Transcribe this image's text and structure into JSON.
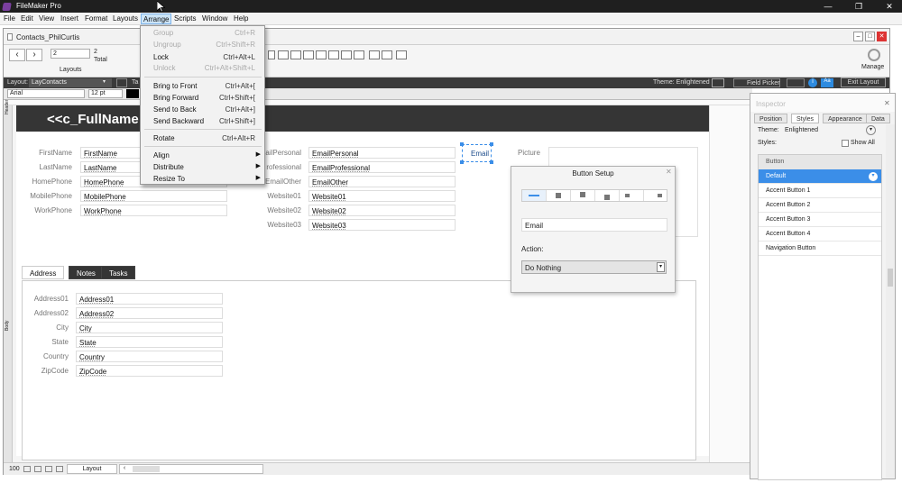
{
  "app": {
    "title": "FileMaker Pro"
  },
  "menu": [
    "File",
    "Edit",
    "View",
    "Insert",
    "Format",
    "Layouts",
    "Arrange",
    "Scripts",
    "Window",
    "Help"
  ],
  "doc": {
    "title": "Contacts_PhilCurtis",
    "record_value": "2",
    "record_count": "2",
    "total_label": "Total",
    "layouts_label": "Layouts",
    "manage_label": "Manage"
  },
  "layoutbar": {
    "layout_label": "Layout:",
    "layout_value": "LayContacts",
    "theme_label": "Theme: Enlightened",
    "field_picker": "Field Picker",
    "exit_layout": "Exit Layout"
  },
  "formatbar": {
    "font": "Arial",
    "size": "12 pt",
    "ta": "Ta"
  },
  "header": {
    "fullname": "<<c_FullName"
  },
  "section_labels": {
    "header": "Header",
    "body": "Body"
  },
  "name_fields": [
    {
      "label": "FirstName",
      "value": "FirstName"
    },
    {
      "label": "LastName",
      "value": "LastName"
    },
    {
      "label": "HomePhone",
      "value": "HomePhone"
    },
    {
      "label": "MobilePhone",
      "value": "MobilePhone"
    },
    {
      "label": "WorkPhone",
      "value": "WorkPhone"
    }
  ],
  "web_fields": [
    {
      "label": "ailPersonal",
      "value": "EmailPersonal"
    },
    {
      "label": "rofessional",
      "value": "EmailProfessional"
    },
    {
      "label": "EmailOther",
      "value": "EmailOther"
    },
    {
      "label": "Website01",
      "value": "Website01"
    },
    {
      "label": "Website02",
      "value": "Website02"
    },
    {
      "label": "Website03",
      "value": "Website03"
    }
  ],
  "email_button": "Email",
  "picture_label": "Picture",
  "tabs": [
    "Address",
    "Notes",
    "Tasks"
  ],
  "address_fields": [
    {
      "label": "Address01",
      "value": "Address01"
    },
    {
      "label": "Address02",
      "value": "Address02"
    },
    {
      "label": "City",
      "value": "City"
    },
    {
      "label": "State",
      "value": "State"
    },
    {
      "label": "Country",
      "value": "Country"
    },
    {
      "label": "ZipCode",
      "value": "ZipCode"
    }
  ],
  "statusbar": {
    "zoom": "100",
    "mode": "Layout"
  },
  "arrange_menu": [
    {
      "label": "Group",
      "key": "Ctrl+R",
      "disabled": true
    },
    {
      "label": "Ungroup",
      "key": "Ctrl+Shift+R",
      "disabled": true
    },
    {
      "label": "Lock",
      "key": "Ctrl+Alt+L",
      "disabled": false
    },
    {
      "label": "Unlock",
      "key": "Ctrl+Alt+Shift+L",
      "disabled": true
    },
    {
      "label": "Bring to Front",
      "key": "Ctrl+Alt+[",
      "disabled": false
    },
    {
      "label": "Bring Forward",
      "key": "Ctrl+Shift+[",
      "disabled": false
    },
    {
      "label": "Send to Back",
      "key": "Ctrl+Alt+]",
      "disabled": false
    },
    {
      "label": "Send Backward",
      "key": "Ctrl+Shift+]",
      "disabled": false
    },
    {
      "label": "Rotate",
      "key": "Ctrl+Alt+R",
      "disabled": false
    },
    {
      "label": "Align",
      "key": "",
      "disabled": false
    },
    {
      "label": "Distribute",
      "key": "",
      "disabled": false
    },
    {
      "label": "Resize To",
      "key": "",
      "disabled": false
    }
  ],
  "button_setup": {
    "title": "Button Setup",
    "label_value": "Email",
    "action_label": "Action:",
    "action_value": "Do Nothing"
  },
  "inspector": {
    "title": "Inspector",
    "tabs": [
      "Position",
      "Styles",
      "Appearance",
      "Data"
    ],
    "theme_label": "Theme:",
    "theme_value": "Enlightened",
    "styles_label": "Styles:",
    "show_all": "Show All",
    "style_items": [
      "Button",
      "Default",
      "Accent Button 1",
      "Accent Button 2",
      "Accent Button 3",
      "Accent Button 4",
      "Navigation Button"
    ]
  },
  "colors": {
    "accent": "#3b8ee8",
    "dark": "#353535",
    "menu_active": "#cce4f7"
  }
}
